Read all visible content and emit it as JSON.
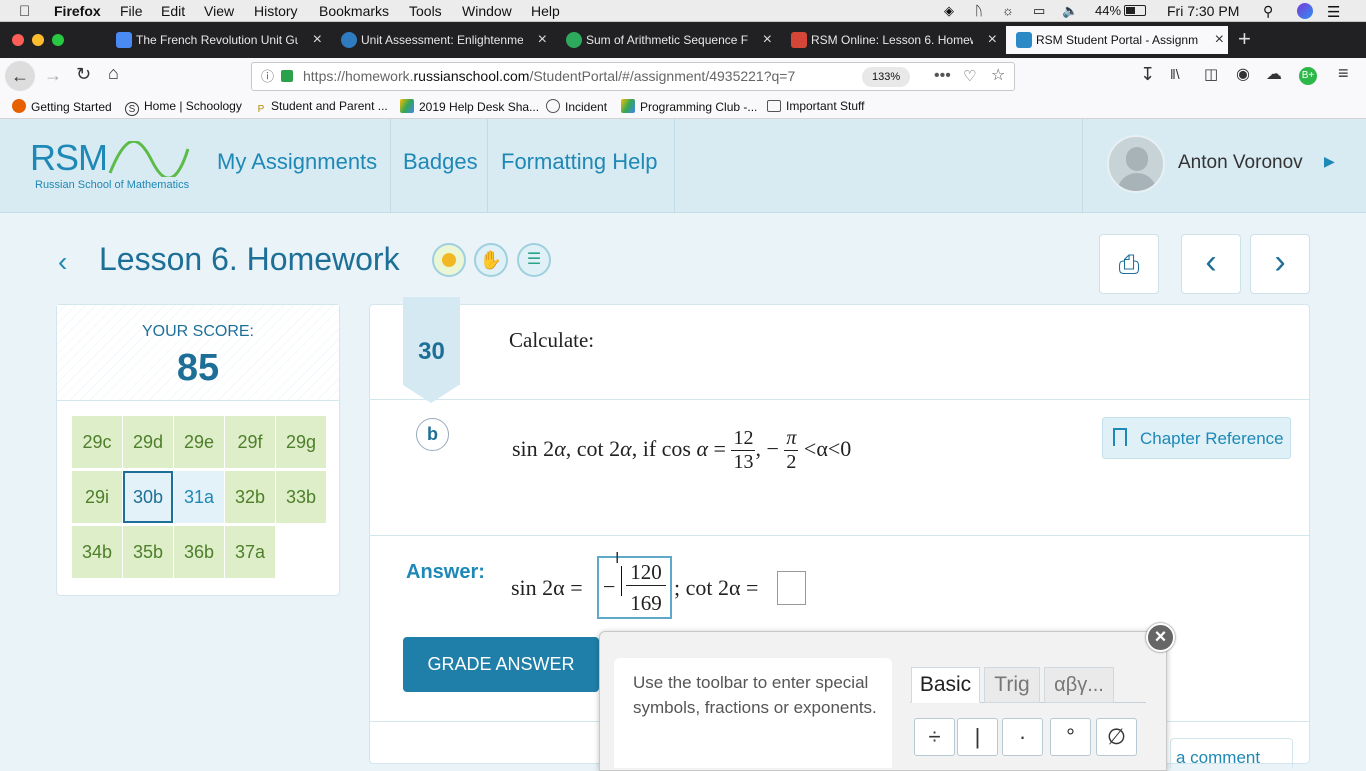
{
  "menubar": {
    "apple": "",
    "app": "Firefox",
    "items": [
      "File",
      "Edit",
      "View",
      "History",
      "Bookmarks",
      "Tools",
      "Window",
      "Help"
    ],
    "battery": "44%",
    "clock": "Fri 7:30 PM"
  },
  "tabs": [
    {
      "title": "The French Revolution Unit Gui",
      "color": "#4a8af4"
    },
    {
      "title": "Unit Assessment: Enlightenmen",
      "color": "#2f7bbf"
    },
    {
      "title": "Sum of Arithmetic Sequence Fo",
      "color": "#2eaa5c"
    },
    {
      "title": "RSM Online: Lesson 6. Homewo",
      "color": "#d44638"
    },
    {
      "title": "RSM Student Portal - Assignme",
      "color": "#2b89c6"
    }
  ],
  "url": {
    "prefix": "https://homework.",
    "domain": "russianschool.com",
    "path": "/StudentPortal/#/assignment/4935221?q=7",
    "zoom": "133%"
  },
  "bookmarks": [
    "Getting Started",
    "Home | Schoology",
    "Student and Parent ...",
    "2019 Help Desk Sha...",
    "Incident",
    "Programming Club -...",
    "Important Stuff"
  ],
  "header": {
    "logo": "RSM",
    "logo_sub": "Russian School of Mathematics",
    "nav": [
      "My Assignments",
      "Badges",
      "Formatting Help"
    ],
    "user": "Anton Voronov"
  },
  "lesson": {
    "title": "Lesson 6. Homework"
  },
  "score": {
    "label": "YOUR SCORE:",
    "value": "85"
  },
  "questions": [
    "29c",
    "29d",
    "29e",
    "29f",
    "29g",
    "29i",
    "30b",
    "31a",
    "32b",
    "33b",
    "34b",
    "35b",
    "36b",
    "37a"
  ],
  "problem": {
    "number": "30",
    "instruction": "Calculate:",
    "part": "b",
    "chapter_ref": "Chapter Reference",
    "expr_a": "sin 2",
    "expr_b": "cot 2",
    "if_word": "if",
    "cos": "cos",
    "alpha": "α",
    "num12": "12",
    "den13": "13",
    "pi": "π",
    "two": "2",
    "tail": "<α<0"
  },
  "answer": {
    "label": "Answer:",
    "sin_part": "sin 2α =",
    "num": "120",
    "den": "169",
    "cot_part": "; cot 2α ="
  },
  "grade_button": "GRADE ANSWER",
  "toolbar": {
    "hint": "Use the toolbar to enter special symbols, fractions or exponents.",
    "tabs": [
      "Basic",
      "Trig",
      "αβγ..."
    ],
    "keys": [
      "÷",
      "|",
      "·",
      "°",
      "∅"
    ]
  },
  "comment_partial": "a comment"
}
